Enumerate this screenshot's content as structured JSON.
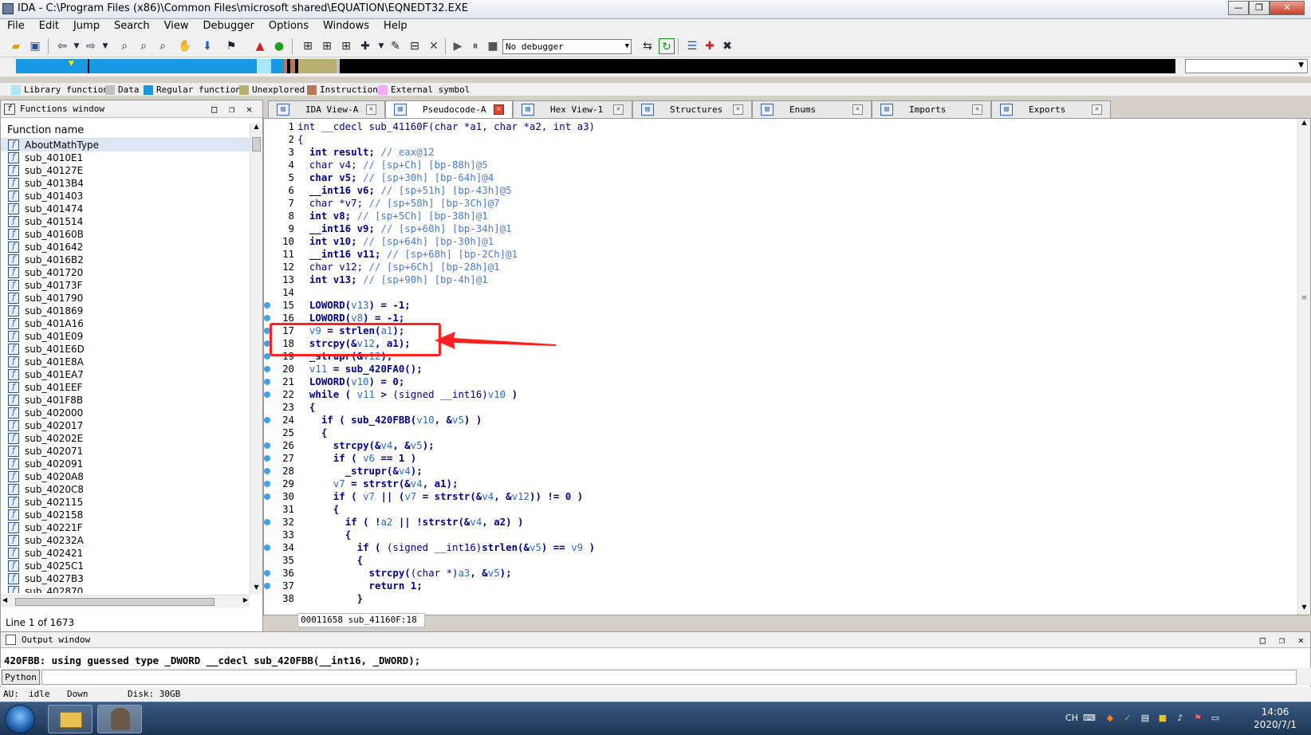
{
  "window": {
    "title": "IDA - C:\\Program Files (x86)\\Common Files\\microsoft shared\\EQUATION\\EQNEDT32.EXE"
  },
  "menu": [
    "File",
    "Edit",
    "Jump",
    "Search",
    "View",
    "Debugger",
    "Options",
    "Windows",
    "Help"
  ],
  "toolbar": {
    "debugger_select": "No debugger"
  },
  "legend": [
    {
      "label": "Library function",
      "color": "#a8e8f8"
    },
    {
      "label": "Data",
      "color": "#c0c0c0"
    },
    {
      "label": "Regular function",
      "color": "#1898e0"
    },
    {
      "label": "Unexplored",
      "color": "#b8b070"
    },
    {
      "label": "Instruction",
      "color": "#b87858"
    },
    {
      "label": "External symbol",
      "color": "#f8a8f8"
    }
  ],
  "functions_window": {
    "title": "Functions window",
    "column_header": "Function name",
    "items": [
      "AboutMathType",
      "sub_4010E1",
      "sub_40127E",
      "sub_4013B4",
      "sub_401403",
      "sub_401474",
      "sub_401514",
      "sub_40160B",
      "sub_401642",
      "sub_4016B2",
      "sub_401720",
      "sub_40173F",
      "sub_401790",
      "sub_401869",
      "sub_401A16",
      "sub_401E09",
      "sub_401E6D",
      "sub_401E8A",
      "sub_401EA7",
      "sub_401EEF",
      "sub_401F8B",
      "sub_402000",
      "sub_402017",
      "sub_40202E",
      "sub_402071",
      "sub_402091",
      "sub_4020A8",
      "sub_4020C8",
      "sub_402115",
      "sub_402158",
      "sub_40221F",
      "sub_40232A",
      "sub_402421",
      "sub_4025C1",
      "sub_4027B3",
      "sub_402870"
    ],
    "status": "Line 1 of 1673"
  },
  "tabs": [
    {
      "label": "IDA View-A",
      "icon": "ida-view-icon",
      "active": false
    },
    {
      "label": "Pseudocode-A",
      "icon": "pseudocode-icon",
      "active": true
    },
    {
      "label": "Hex View-1",
      "icon": "hex-view-icon",
      "active": false
    },
    {
      "label": "Structures",
      "icon": "structures-icon",
      "active": false
    },
    {
      "label": "Enums",
      "icon": "enums-icon",
      "active": false
    },
    {
      "label": "Imports",
      "icon": "imports-icon",
      "active": false
    },
    {
      "label": "Exports",
      "icon": "exports-icon",
      "active": false
    }
  ],
  "code": {
    "lines": [
      {
        "n": "1",
        "bp": false,
        "html": "int __cdecl sub_41160F(char *a1, char *a2, int a3)"
      },
      {
        "n": "2",
        "bp": false,
        "html": "{"
      },
      {
        "n": "3",
        "bp": false,
        "html": "  <b>int result;</b> <span class='cmt'>// eax@12</span>"
      },
      {
        "n": "4",
        "bp": false,
        "html": "  char v4; <span class='cmt'>// [sp+Ch] [bp-88h]@5</span>"
      },
      {
        "n": "5",
        "bp": false,
        "html": "  <b>char v5;</b> <span class='cmt'>// [sp+30h] [bp-64h]@4</span>"
      },
      {
        "n": "6",
        "bp": false,
        "html": "  <b>__int16 v6;</b> <span class='cmt'>// [sp+51h] [bp-43h]@5</span>"
      },
      {
        "n": "7",
        "bp": false,
        "html": "  char *v7; <span class='cmt'>// [sp+58h] [bp-3Ch]@7</span>"
      },
      {
        "n": "8",
        "bp": false,
        "html": "  <b>int v8;</b> <span class='cmt'>// [sp+5Ch] [bp-38h]@1</span>"
      },
      {
        "n": "9",
        "bp": false,
        "html": "  <b>__int16 v9;</b> <span class='cmt'>// [sp+60h] [bp-34h]@1</span>"
      },
      {
        "n": "10",
        "bp": false,
        "html": "  <b>int v10;</b> <span class='cmt'>// [sp+64h] [bp-30h]@1</span>"
      },
      {
        "n": "11",
        "bp": false,
        "html": "  <b>__int16 v11;</b> <span class='cmt'>// [sp+68h] [bp-2Ch]@1</span>"
      },
      {
        "n": "12",
        "bp": false,
        "html": "  char v12; <span class='cmt'>// [sp+6Ch] [bp-28h]@1</span>"
      },
      {
        "n": "13",
        "bp": false,
        "html": "  <b>int v13;</b> <span class='cmt'>// [sp+90h] [bp-4h]@1</span>"
      },
      {
        "n": "14",
        "bp": false,
        "html": ""
      },
      {
        "n": "15",
        "bp": true,
        "html": "  <b>LOWORD(</b><span class='gv'>v13</span><b>) = -1;</b>"
      },
      {
        "n": "16",
        "bp": true,
        "html": "  <b>LOWORD(</b><span class='gv'>v8</span><b>) = -1;</b>"
      },
      {
        "n": "17",
        "bp": true,
        "html": "  <span class='gv'>v9</span> <b>= strlen(</b><span class='gv'>a1</span><b>);</b>"
      },
      {
        "n": "18",
        "bp": true,
        "html": "  <b>strcpy(&amp;</b><span class='gv'>v12</span><b>, a1);</b>"
      },
      {
        "n": "19",
        "bp": true,
        "html": "  <b>_strupr(&amp;</b><span class='gv'>v12</span><b>);</b>"
      },
      {
        "n": "20",
        "bp": true,
        "html": "  <span class='gv'>v11</span> <b>= sub_420FA0();</b>"
      },
      {
        "n": "21",
        "bp": true,
        "html": "  <b>LOWORD(</b><span class='gv'>v10</span><b>) = 0;</b>"
      },
      {
        "n": "22",
        "bp": true,
        "html": "  <b>while (</b> <span class='gv'>v11</span> <b>&gt;</b> (signed __int16)<span class='gv'>v10</span> <b>)</b>"
      },
      {
        "n": "23",
        "bp": false,
        "html": "  <b>{</b>"
      },
      {
        "n": "24",
        "bp": true,
        "html": "    <b>if ( sub_420FBB(</b><span class='gv'>v10</span><b>, &amp;</b><span class='gv'>v5</span><b>) )</b>"
      },
      {
        "n": "25",
        "bp": false,
        "html": "    <b>{</b>"
      },
      {
        "n": "26",
        "bp": true,
        "html": "      <b>strcpy(&amp;</b><span class='gv'>v4</span><b>, &amp;</b><span class='gv'>v5</span><b>);</b>"
      },
      {
        "n": "27",
        "bp": true,
        "html": "      <b>if (</b> <span class='gv'>v6</span> <b>== 1 )</b>"
      },
      {
        "n": "28",
        "bp": true,
        "html": "        <b>_strupr(&amp;</b><span class='gv'>v4</span><b>);</b>"
      },
      {
        "n": "29",
        "bp": true,
        "html": "      <span class='gv'>v7</span> <b>= strstr(&amp;</b><span class='gv'>v4</span><b>, a1);</b>"
      },
      {
        "n": "30",
        "bp": true,
        "html": "      <b>if (</b> <span class='gv'>v7</span> <b>|| (</b><span class='gv'>v7</span> <b>= strstr(&amp;</b><span class='gv'>v4</span><b>, &amp;</b><span class='gv'>v12</span><b>)) != 0 )</b>"
      },
      {
        "n": "31",
        "bp": false,
        "html": "      <b>{</b>"
      },
      {
        "n": "32",
        "bp": true,
        "html": "        <b>if ( !</b><span class='gv'>a2</span> <b>|| !strstr(&amp;</b><span class='gv'>v4</span><b>, a2) )</b>"
      },
      {
        "n": "33",
        "bp": false,
        "html": "        <b>{</b>"
      },
      {
        "n": "34",
        "bp": true,
        "html": "          <b>if (</b> (signed __int16)<b>strlen(&amp;</b><span class='gv'>v5</span><b>) ==</b> <span class='gv'>v9</span> <b>)</b>"
      },
      {
        "n": "35",
        "bp": false,
        "html": "          <b>{</b>"
      },
      {
        "n": "36",
        "bp": true,
        "html": "            <b>strcpy(</b>(char *)<span class='gv'>a3</span><b>, &amp;</b><span class='gv'>v5</span><b>);</b>"
      },
      {
        "n": "37",
        "bp": true,
        "html": "            <b>return 1;</b>"
      },
      {
        "n": "38",
        "bp": false,
        "html": "          <b>}</b>"
      }
    ],
    "status_addr": "00011658",
    "status_loc": "sub_41160F:18"
  },
  "output_window": {
    "title": "Output window",
    "text": "420FBB: using guessed type _DWORD __cdecl sub_420FBB(__int16, _DWORD);",
    "python_button": "Python"
  },
  "statusbar": {
    "au_label": "AU:",
    "au_state": "idle",
    "direction": "Down",
    "disk": "Disk: 30GB"
  },
  "taskbar": {
    "time": "14:06",
    "date": "2020/7/1",
    "lang": "CH"
  }
}
